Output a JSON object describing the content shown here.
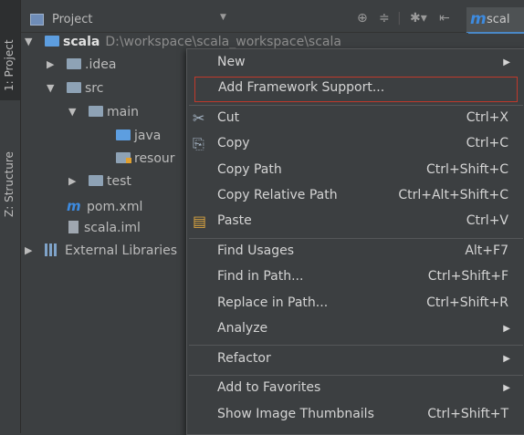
{
  "sidebar": {
    "tabs": [
      {
        "label": "1: Project"
      },
      {
        "label": "Z: Structure"
      }
    ]
  },
  "toolbar": {
    "title": "Project",
    "icons": [
      "dropdown-arrow-icon",
      "target-icon",
      "collapse-all-icon",
      "gear-icon",
      "hide-icon"
    ]
  },
  "editor_tab": {
    "label": "scal",
    "icon": "m"
  },
  "tree": [
    {
      "label": "scala",
      "path": "D:\\workspace\\scala_workspace\\scala",
      "arrow": "▼",
      "icon": "module-folder",
      "bold": true
    },
    {
      "label": ".idea",
      "arrow": "▶",
      "icon": "folder"
    },
    {
      "label": "src",
      "arrow": "▼",
      "icon": "folder"
    },
    {
      "label": "main",
      "arrow": "▼",
      "icon": "folder"
    },
    {
      "label": "java",
      "arrow": "",
      "icon": "source-folder"
    },
    {
      "label": "resour",
      "arrow": "",
      "icon": "resource-folder"
    },
    {
      "label": "test",
      "arrow": "▶",
      "icon": "folder"
    },
    {
      "label": "pom.xml",
      "arrow": "",
      "icon": "maven-file"
    },
    {
      "label": "scala.iml",
      "arrow": "",
      "icon": "iml-file"
    },
    {
      "label": "External Libraries",
      "arrow": "▶",
      "icon": "library"
    }
  ],
  "context_menu": {
    "items": [
      {
        "label": "New",
        "shortcut": "",
        "submenu": true
      },
      {
        "label": "Add Framework Support...",
        "shortcut": "",
        "highlighted": true
      },
      {
        "label": "Cut",
        "shortcut": "Ctrl+X",
        "icon": "scissors-icon"
      },
      {
        "label": "Copy",
        "shortcut": "Ctrl+C",
        "icon": "copy-icon"
      },
      {
        "label": "Copy Path",
        "shortcut": "Ctrl+Shift+C"
      },
      {
        "label": "Copy Relative Path",
        "shortcut": "Ctrl+Alt+Shift+C"
      },
      {
        "label": "Paste",
        "shortcut": "Ctrl+V",
        "icon": "paste-icon"
      },
      {
        "label": "Find Usages",
        "shortcut": "Alt+F7"
      },
      {
        "label": "Find in Path...",
        "shortcut": "Ctrl+Shift+F"
      },
      {
        "label": "Replace in Path...",
        "shortcut": "Ctrl+Shift+R"
      },
      {
        "label": "Analyze",
        "shortcut": "",
        "submenu": true
      },
      {
        "label": "Refactor",
        "shortcut": "",
        "submenu": true
      },
      {
        "label": "Add to Favorites",
        "shortcut": "",
        "submenu": true
      },
      {
        "label": "Show Image Thumbnails",
        "shortcut": "Ctrl+Shift+T"
      }
    ]
  },
  "colors": {
    "background": "#3c3f41",
    "highlight_border": "#c0392b",
    "accent": "#3d8be0"
  }
}
